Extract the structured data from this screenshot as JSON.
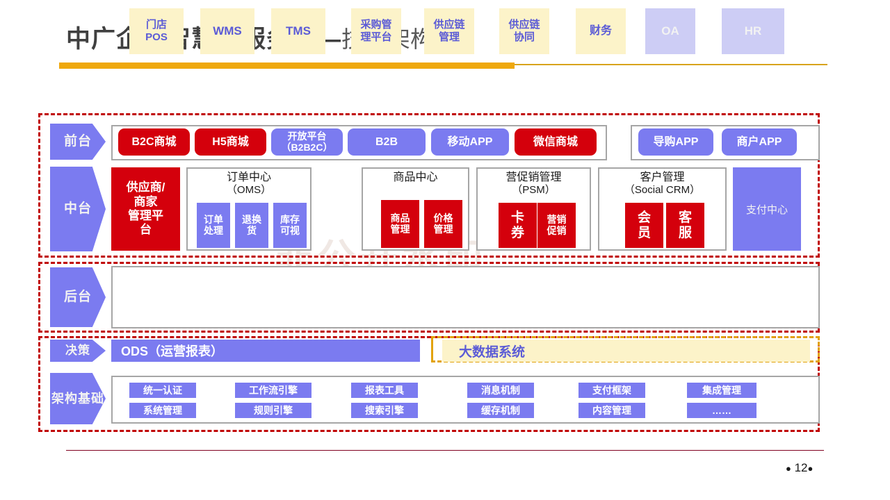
{
  "slide": {
    "title_main": "中广企业智慧云服务——",
    "title_sub": "技术架构图",
    "page_number": "12",
    "dot_left": "●",
    "dot_right": "●",
    "watermark": "非公开水印"
  },
  "colors": {
    "red": "#D4000C",
    "purple": "#7B7BF0",
    "cream": "#FCF3C9",
    "lavender": "#CDCDF5",
    "gold": "#EFA80C",
    "frame_red": "#C00000",
    "panel_border": "#A6A6A6"
  },
  "layers": {
    "front": {
      "tag": "前台"
    },
    "middle": {
      "tag": "中台"
    },
    "back": {
      "tag": "后台"
    },
    "decision": {
      "tag": "决策"
    },
    "foundation": {
      "tag": "架构<br>基础",
      "line1": "架构",
      "line2": "基础"
    }
  },
  "front_stage": {
    "main_items": [
      {
        "label": "B2C商城",
        "style": "red"
      },
      {
        "label": "H5商城",
        "style": "red"
      },
      {
        "label": "开放平台\n（B2B2C）",
        "style": "purple"
      },
      {
        "label": "B2B",
        "style": "purple"
      },
      {
        "label": "移动APP",
        "style": "purple"
      },
      {
        "label": "微信商城",
        "style": "red"
      }
    ],
    "side_items": [
      {
        "label": "导购APP",
        "style": "purple"
      },
      {
        "label": "商户APP",
        "style": "purple"
      }
    ]
  },
  "middle_stage": {
    "supplier_platform": "供应商/商家管理平台",
    "payment_center": "支付中心",
    "groups": [
      {
        "title": "订单中心",
        "subtitle": "（OMS）",
        "items": [
          {
            "label": "订单\n处理",
            "style": "purple"
          },
          {
            "label": "退换\n货",
            "style": "purple"
          },
          {
            "label": "库存\n可视",
            "style": "purple"
          }
        ]
      },
      {
        "title": "商品中心",
        "subtitle": "",
        "items": [
          {
            "label": "商品\n管理",
            "style": "red"
          },
          {
            "label": "价格\n管理",
            "style": "red"
          }
        ]
      },
      {
        "title": "营促销管理",
        "subtitle": "（PSM）",
        "items": [
          {
            "label": "卡\n券",
            "style": "red"
          },
          {
            "label": "营销\n促销",
            "style": "red"
          }
        ]
      },
      {
        "title": "客户管理",
        "subtitle": "（Social CRM）",
        "items": [
          {
            "label": "会\n员",
            "style": "red"
          },
          {
            "label": "客\n服",
            "style": "red"
          }
        ]
      }
    ]
  },
  "back_office": {
    "items": [
      {
        "label": "门店\nPOS",
        "style": "cream"
      },
      {
        "label": "WMS",
        "style": "cream"
      },
      {
        "label": "TMS",
        "style": "cream"
      },
      {
        "label": "采购管\n理平台",
        "style": "cream"
      },
      {
        "label": "供应链\n管理",
        "style": "cream"
      },
      {
        "label": "供应链\n协同",
        "style": "cream"
      },
      {
        "label": "财务",
        "style": "cream"
      },
      {
        "label": "OA",
        "style": "lavender"
      },
      {
        "label": "HR",
        "style": "lavender"
      }
    ]
  },
  "decision": {
    "ods_label": "ODS（运营报表）",
    "bigdata_label": "大数据系统"
  },
  "foundation": {
    "row1": [
      "统一认证",
      "工作流引擎",
      "报表工具",
      "消息机制",
      "支付框架",
      "集成管理"
    ],
    "row2": [
      "系统管理",
      "规则引擎",
      "搜索引擎",
      "缓存机制",
      "内容管理",
      "……"
    ]
  }
}
